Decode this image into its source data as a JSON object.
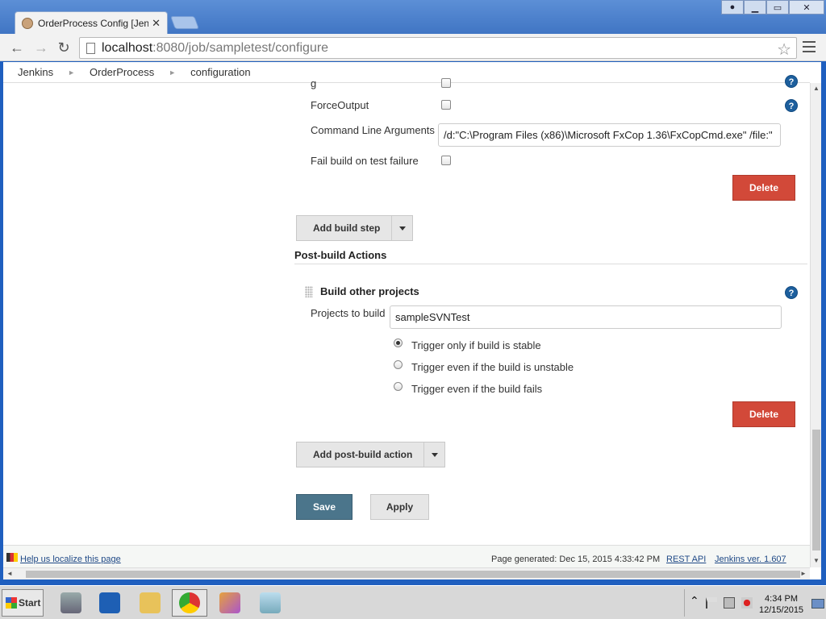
{
  "browser": {
    "tab_title": "OrderProcess Config [Jenkins",
    "tab_close": "✕",
    "url_host": "localhost",
    "url_rest": ":8080/job/sampletest/configure"
  },
  "breadcrumbs": [
    {
      "label": "Jenkins"
    },
    {
      "label": "OrderProcess"
    },
    {
      "label": "configuration"
    }
  ],
  "build_step": {
    "force_output_label": "ForceOutput",
    "command_line_label": "Command Line Arguments",
    "command_line_value": "/d:\"C:\\Program Files (x86)\\Microsoft FxCop 1.36\\FxCopCmd.exe\" /file:\"",
    "fail_build_label": "Fail build on test failure",
    "delete_label": "Delete",
    "add_build_step_label": "Add build step",
    "partial_label": "g"
  },
  "post_build": {
    "section_title": "Post-build Actions",
    "build_other_title": "Build other projects",
    "projects_label": "Projects to build",
    "projects_value": "sampleSVNTest",
    "radio_options": [
      {
        "label": "Trigger only if build is stable",
        "checked": true
      },
      {
        "label": "Trigger even if the build is unstable",
        "checked": false
      },
      {
        "label": "Trigger even if the build fails",
        "checked": false
      }
    ],
    "delete_label": "Delete",
    "add_action_label": "Add post-build action"
  },
  "actions": {
    "save_label": "Save",
    "apply_label": "Apply"
  },
  "footer": {
    "localize_link": "Help us localize this page",
    "page_generated": "Page generated: Dec 15, 2015 4:33:42 PM",
    "rest_api": "REST API",
    "jenkins_version": "Jenkins ver. 1.607"
  },
  "taskbar": {
    "start_label": "Start",
    "time": "4:34 PM",
    "date": "12/15/2015",
    "tray_chevron": "⌃"
  },
  "help_glyph": "?",
  "colors": {
    "delete_red": "#d24939",
    "save_blue": "#4b758b",
    "help_blue": "#1d5f9d"
  }
}
